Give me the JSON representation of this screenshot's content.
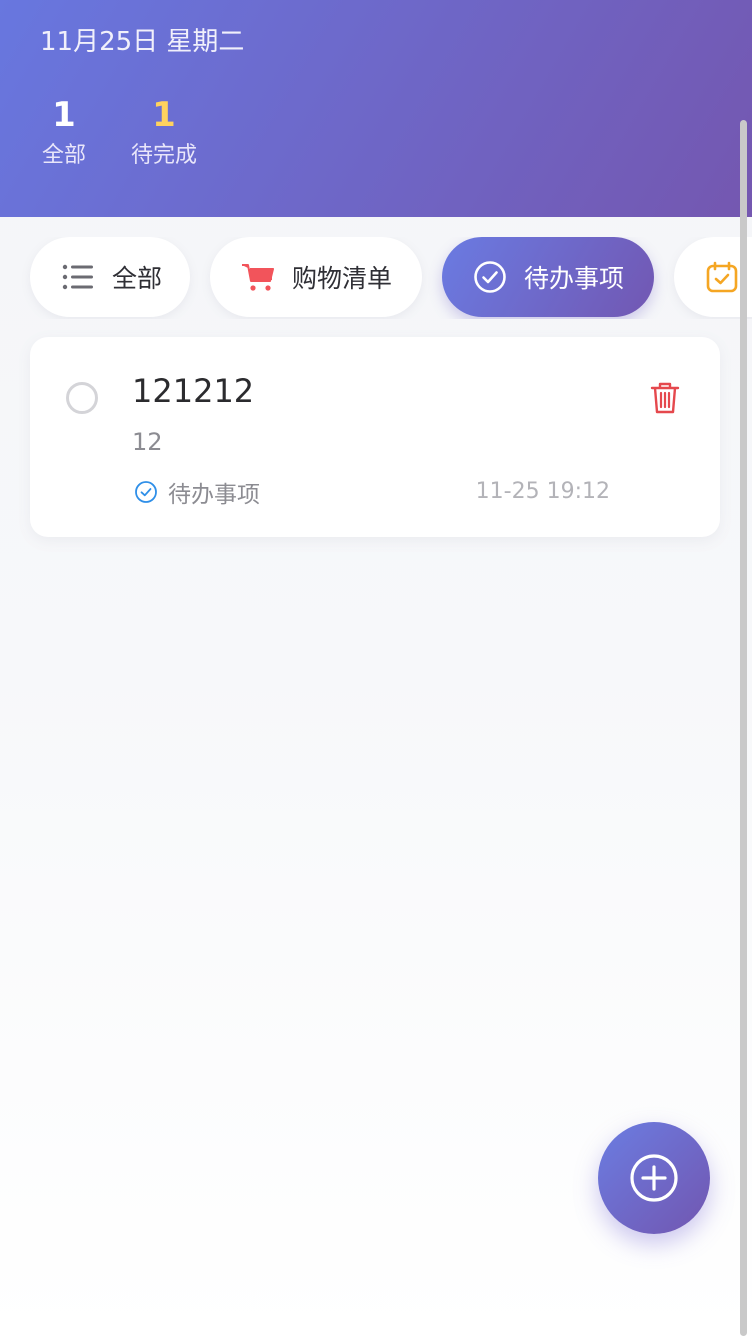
{
  "header": {
    "date": "11月25日 星期二",
    "stats": {
      "all": {
        "value": "1",
        "label": "全部"
      },
      "pending": {
        "value": "1",
        "label": "待完成"
      }
    }
  },
  "tabs": [
    {
      "label": "全部",
      "icon": "list-icon",
      "active": false
    },
    {
      "label": "购物清单",
      "icon": "cart-icon",
      "active": false
    },
    {
      "label": "待办事项",
      "icon": "check-circle-icon",
      "active": true
    },
    {
      "label": "",
      "icon": "calendar-check-icon",
      "active": false
    }
  ],
  "items": [
    {
      "title": "121212",
      "note": "12",
      "category": "待办事项",
      "time": "11-25 19:12",
      "done": false
    }
  ],
  "colors": {
    "header_gradient": [
      "#6877df",
      "#7457b0"
    ],
    "pending_accent": "#ffd25e",
    "cart_icon": "#f2545b",
    "calendar_icon": "#f5a623",
    "delete_icon": "#e5484d",
    "category_icon": "#2f8fe8"
  }
}
